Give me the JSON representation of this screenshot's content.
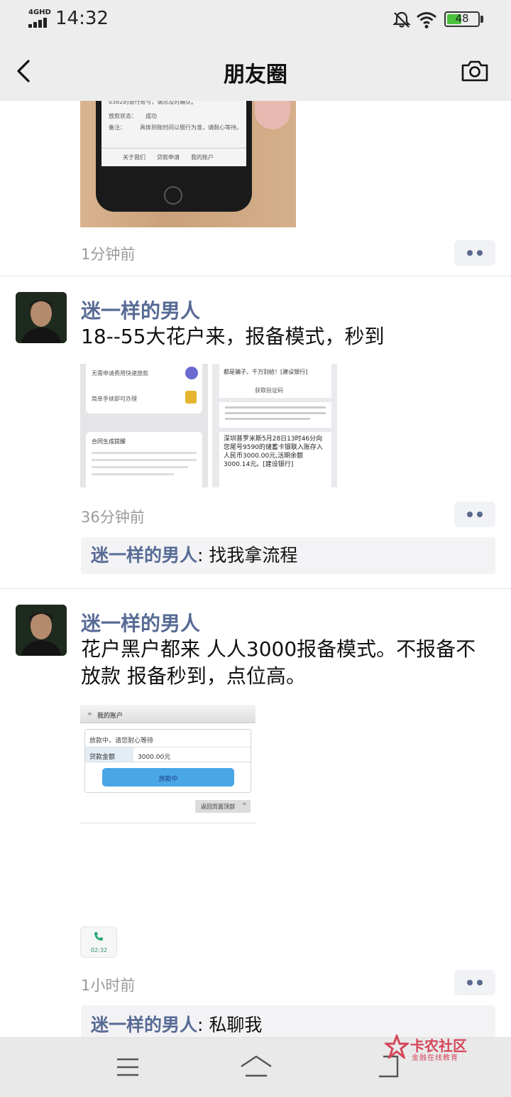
{
  "status_bar": {
    "network": "4GHD",
    "time": "14:32",
    "battery": "48",
    "battery_level": 0.48,
    "icons": [
      "signal-icon",
      "mute-bell-icon",
      "wifi-icon",
      "battery-icon"
    ]
  },
  "nav": {
    "title": "朋友圈",
    "icons": [
      "back-chevron-icon",
      "camera-icon"
    ]
  },
  "posts": [
    {
      "time": "1分钟前"
    },
    {
      "author": "迷一样的男人",
      "text": "18--55大花户来，报备模式，秒到",
      "time": "36分钟前",
      "comment": {
        "author": "迷一样的男人",
        "separator": ": ",
        "text": "找我拿流程"
      },
      "image1": {
        "lines": [
          "无需申请费用快速放款",
          "简单手续即可办理",
          "合同生成提醒"
        ]
      },
      "image2": {
        "lines": [
          "都是骗子，千万别给！[建设银行]",
          "获取验证码",
          "深圳普罗米斯5月28日13时46分向您尾号9590的储蓄卡银联入账存入人民币3000.00元,活期余额3000.14元。[建设银行]"
        ]
      }
    },
    {
      "author": "迷一样的男人",
      "text": "花户黑户都来 人人3000报备模式。不报备不放款 报备秒到，点位高。",
      "time": "1小时前",
      "comment": {
        "author": "迷一样的男人",
        "separator": ": ",
        "text": "私聊我"
      },
      "image": {
        "header": "我的账户",
        "notice": "放款中，请您耐心等待",
        "field_label": "贷款金额",
        "field_value": "3000.00元",
        "button": "放款中",
        "back_top": "返回页面顶部",
        "call_time": "02:32"
      }
    }
  ],
  "bottom_nav": {
    "icons": [
      "menu-icon",
      "home-icon",
      "back-icon"
    ]
  },
  "watermark": {
    "title": "卡农社区",
    "subtitle": "金融在线教育"
  }
}
